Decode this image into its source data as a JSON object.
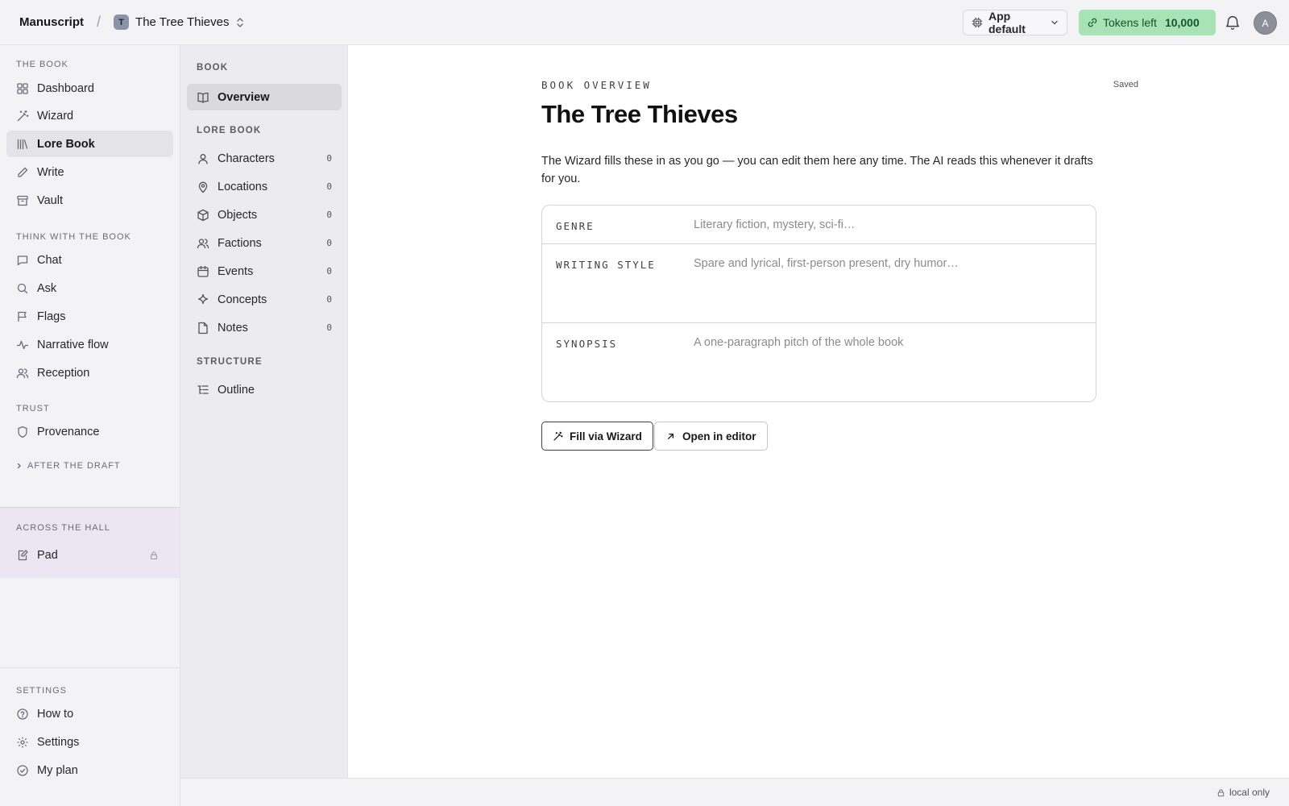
{
  "topbar": {
    "app_name": "Manuscript",
    "separator": "/",
    "book_initial": "T",
    "book_title": "The Tree Thieves",
    "model_selector": "App default",
    "tokens_label": "Tokens left",
    "tokens_count": "10,000",
    "avatar_initial": "A"
  },
  "sidebar": {
    "the_book_label": "THE BOOK",
    "the_book_items": [
      {
        "label": "Dashboard",
        "icon": "grid-icon"
      },
      {
        "label": "Wizard",
        "icon": "magic-wand-icon"
      },
      {
        "label": "Lore Book",
        "icon": "library-icon",
        "active": true
      },
      {
        "label": "Write",
        "icon": "pencil-icon"
      },
      {
        "label": "Vault",
        "icon": "archive-icon"
      }
    ],
    "think_label": "THINK WITH THE BOOK",
    "think_items": [
      {
        "label": "Chat",
        "icon": "message-icon"
      },
      {
        "label": "Ask",
        "icon": "search-icon"
      },
      {
        "label": "Flags",
        "icon": "flag-icon"
      },
      {
        "label": "Narrative flow",
        "icon": "activity-icon"
      },
      {
        "label": "Reception",
        "icon": "users-icon"
      }
    ],
    "trust_label": "TRUST",
    "trust_items": [
      {
        "label": "Provenance",
        "icon": "shield-icon"
      }
    ],
    "after_draft_label": "AFTER THE DRAFT",
    "hall_label": "ACROSS THE HALL",
    "hall_items": [
      {
        "label": "Pad",
        "icon": "note-edit-icon",
        "locked": true
      }
    ],
    "settings_label": "SETTINGS",
    "settings_items": [
      {
        "label": "How to",
        "icon": "help-circle-icon"
      },
      {
        "label": "Settings",
        "icon": "gear-icon"
      },
      {
        "label": "My plan",
        "icon": "check-circle-icon"
      }
    ]
  },
  "lore_nav": {
    "book_label": "BOOK",
    "book_items": [
      {
        "label": "Overview",
        "icon": "open-book-icon",
        "active": true
      }
    ],
    "lore_label": "LORE BOOK",
    "lore_items": [
      {
        "label": "Characters",
        "count": "0",
        "icon": "user-icon"
      },
      {
        "label": "Locations",
        "count": "0",
        "icon": "map-pin-icon"
      },
      {
        "label": "Objects",
        "count": "0",
        "icon": "box-icon"
      },
      {
        "label": "Factions",
        "count": "0",
        "icon": "users-icon"
      },
      {
        "label": "Events",
        "count": "0",
        "icon": "calendar-icon"
      },
      {
        "label": "Concepts",
        "count": "0",
        "icon": "sparkle-icon"
      },
      {
        "label": "Notes",
        "count": "0",
        "icon": "file-icon"
      }
    ],
    "structure_label": "STRUCTURE",
    "structure_items": [
      {
        "label": "Outline",
        "icon": "list-tree-icon"
      }
    ]
  },
  "main": {
    "eyebrow": "BOOK OVERVIEW",
    "saved_status": "Saved",
    "title": "The Tree Thieves",
    "description": "The Wizard fills these in as you go — you can edit them here any time. The AI reads this whenever it drafts for you.",
    "fields": [
      {
        "label": "GENRE",
        "placeholder": "Literary fiction, mystery, sci-fi…"
      },
      {
        "label": "WRITING STYLE",
        "placeholder": "Spare and lyrical, first-person present, dry humor…"
      },
      {
        "label": "SYNOPSIS",
        "placeholder": "A one-paragraph pitch of the whole book"
      }
    ],
    "fill_wizard_button": "Fill via Wizard",
    "open_editor_button": "Open in editor"
  },
  "footer": {
    "storage_status": "local only"
  },
  "colors": {
    "token_badge_bg": "#a7e3b4",
    "hall_section_bg": "#ece6f3",
    "active_item_bg": "#e3e3e8"
  }
}
